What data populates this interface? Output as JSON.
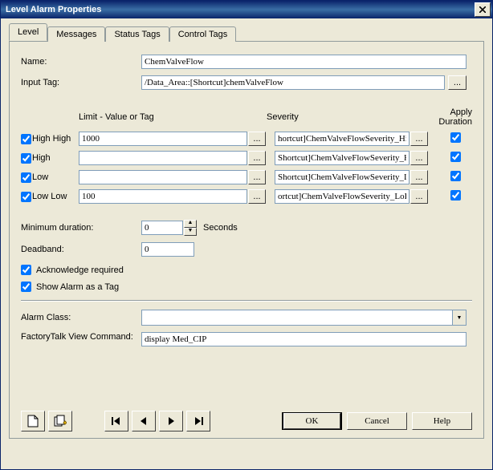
{
  "window": {
    "title": "Level Alarm Properties"
  },
  "tabs": [
    {
      "label": "Level",
      "active": true
    },
    {
      "label": "Messages",
      "active": false
    },
    {
      "label": "Status Tags",
      "active": false
    },
    {
      "label": "Control Tags",
      "active": false
    }
  ],
  "name_label": "Name:",
  "name_value": "ChemValveFlow",
  "input_tag_label": "Input Tag:",
  "input_tag_value": "/Data_Area::[Shortcut]chemValveFlow",
  "browse_label": "...",
  "columns": {
    "limit": "Limit - Value or Tag",
    "severity": "Severity",
    "apply": "Apply Duration"
  },
  "levels": [
    {
      "key": "hihi",
      "label": "High High",
      "checked": true,
      "limit": "1000",
      "severity": "hortcut]ChemValveFlowSeverity_HiHi",
      "apply": true
    },
    {
      "key": "hi",
      "label": "High",
      "checked": true,
      "limit": "",
      "severity": "Shortcut]ChemValveFlowSeverity_Hi",
      "apply": true
    },
    {
      "key": "lo",
      "label": "Low",
      "checked": true,
      "limit": "",
      "severity": "Shortcut]ChemValveFlowSeverity_Lo",
      "apply": true
    },
    {
      "key": "lolo",
      "label": "Low Low",
      "checked": true,
      "limit": "100",
      "severity": "ortcut]ChemValveFlowSeverity_LoLo",
      "apply": true
    }
  ],
  "min_duration": {
    "label": "Minimum duration:",
    "value": "0",
    "unit": "Seconds"
  },
  "deadband": {
    "label": "Deadband:",
    "value": "0"
  },
  "ack_required": {
    "label": "Acknowledge required",
    "checked": true
  },
  "show_as_tag": {
    "label": "Show Alarm as a Tag",
    "checked": true
  },
  "alarm_class": {
    "label": "Alarm Class:",
    "value": ""
  },
  "ftv_command": {
    "label": "FactoryTalk View Command:",
    "value": "display Med_CIP"
  },
  "buttons": {
    "ok": "OK",
    "cancel": "Cancel",
    "help": "Help"
  },
  "toolbar": {
    "new": "new-icon",
    "copy": "copy-wizard-icon",
    "first": "first-icon",
    "prev": "prev-icon",
    "next": "next-icon",
    "last": "last-icon"
  }
}
